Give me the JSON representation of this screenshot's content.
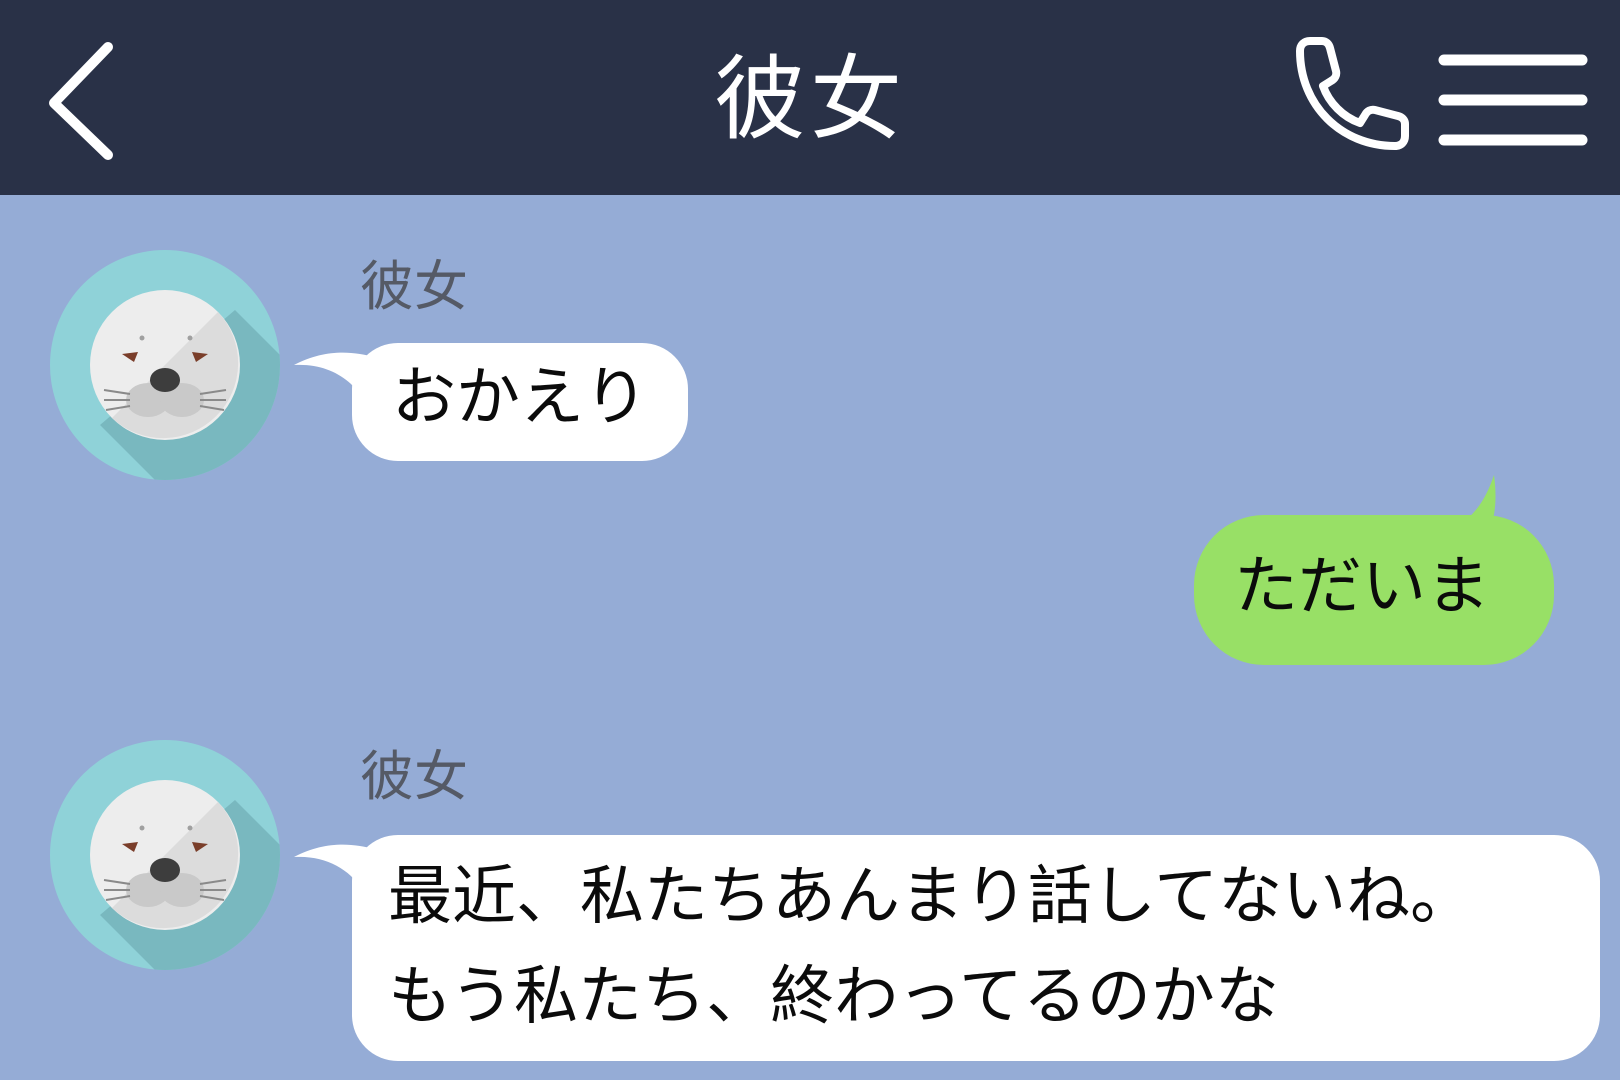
{
  "header": {
    "title": "彼女",
    "back_icon": "chevron-left-icon",
    "call_icon": "phone-icon",
    "menu_icon": "menu-icon"
  },
  "colors": {
    "header_bg": "#293147",
    "chat_bg": "#95acd6",
    "incoming_bubble": "#ffffff",
    "outgoing_bubble": "#98e066",
    "avatar_bg": "#8fd2d8",
    "name_text": "#555a66"
  },
  "messages": [
    {
      "direction": "incoming",
      "sender": "彼女",
      "avatar_icon": "seal-icon",
      "lines": [
        "おかえり"
      ]
    },
    {
      "direction": "outgoing",
      "lines": [
        "ただいま"
      ]
    },
    {
      "direction": "incoming",
      "sender": "彼女",
      "avatar_icon": "seal-icon",
      "lines": [
        "最近、私たちあんまり話してないね。",
        "もう私たち、終わってるのかな"
      ]
    }
  ]
}
